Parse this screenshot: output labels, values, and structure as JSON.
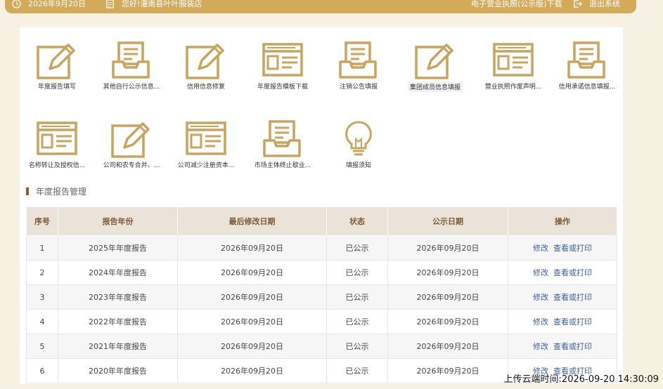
{
  "topbar": {
    "date": "2026年9月20日",
    "greeting": "您好!灌南县叶叶服装店",
    "license_link": "电子营业执照(公示版)下载",
    "logout": "退出系统"
  },
  "tiles": [
    {
      "label": "年度报告填写",
      "icon": "edit-icon"
    },
    {
      "label": "其他自行公示信息...",
      "icon": "inbox-icon"
    },
    {
      "label": "信用信息修复",
      "icon": "edit-icon"
    },
    {
      "label": "年度报告模板下载",
      "icon": "form-window-icon"
    },
    {
      "label": "注销公告填报",
      "icon": "inbox-icon"
    },
    {
      "label": "集团成员信息填报",
      "icon": "edit-icon"
    },
    {
      "label": "营业执照作废声明...",
      "icon": "form-window-icon"
    },
    {
      "label": "信用承诺信息填报...",
      "icon": "inbox-icon"
    },
    {
      "label": "名称转让及授权信...",
      "icon": "form-window-icon"
    },
    {
      "label": "公司和农专合并、...",
      "icon": "edit-icon"
    },
    {
      "label": "公司减少注册资本...",
      "icon": "form-window-icon"
    },
    {
      "label": "市场主体终止歇业...",
      "icon": "inbox-icon"
    },
    {
      "label": "填报须知",
      "icon": "lightbulb-icon"
    }
  ],
  "section_title": "年度报告管理",
  "table": {
    "headers": [
      "序号",
      "报告年份",
      "最后修改日期",
      "状态",
      "公示日期",
      "操作"
    ],
    "rows": [
      {
        "no": "1",
        "year": "2025年年度报告",
        "modified": "2026年09月20日",
        "status": "已公示",
        "publish": "2026年09月20日",
        "edit": "修改",
        "view": "查看或打印"
      },
      {
        "no": "2",
        "year": "2024年年度报告",
        "modified": "2026年09月20日",
        "status": "已公示",
        "publish": "2026年09月20日",
        "edit": "修改",
        "view": "查看或打印"
      },
      {
        "no": "3",
        "year": "2023年年度报告",
        "modified": "2026年09月20日",
        "status": "已公示",
        "publish": "2026年09月20日",
        "edit": "修改",
        "view": "查看或打印"
      },
      {
        "no": "4",
        "year": "2022年年度报告",
        "modified": "2026年09月20日",
        "status": "已公示",
        "publish": "2026年09月20日",
        "edit": "修改",
        "view": "查看或打印"
      },
      {
        "no": "5",
        "year": "2021年年度报告",
        "modified": "2026年09月20日",
        "status": "已公示",
        "publish": "2026年09月20日",
        "edit": "修改",
        "view": "查看或打印"
      },
      {
        "no": "6",
        "year": "2020年年度报告",
        "modified": "2026年09月20日",
        "status": "已公示",
        "publish": "2026年09月20日",
        "edit": "修改",
        "view": "查看或打印"
      }
    ]
  },
  "upload_stamp": "上传云端时间:2026-09-20 14:30:09",
  "colors": {
    "accent": "#d3a95a",
    "header_bg": "#ebe3d8",
    "link": "#3b5fa0"
  }
}
